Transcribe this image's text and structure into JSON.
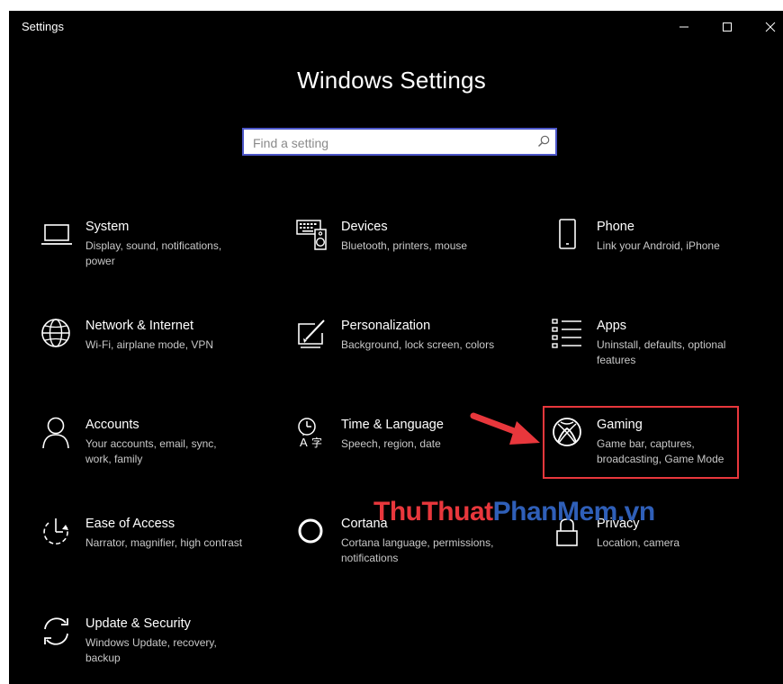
{
  "window": {
    "title": "Settings"
  },
  "header": {
    "title": "Windows Settings"
  },
  "search": {
    "placeholder": "Find a setting",
    "value": ""
  },
  "tiles": [
    {
      "name": "System",
      "description": "Display, sound, notifications, power",
      "icon": "laptop-icon"
    },
    {
      "name": "Devices",
      "description": "Bluetooth, printers, mouse",
      "icon": "keyboard-speaker-icon"
    },
    {
      "name": "Phone",
      "description": "Link your Android, iPhone",
      "icon": "phone-icon"
    },
    {
      "name": "Network & Internet",
      "description": "Wi-Fi, airplane mode, VPN",
      "icon": "globe-icon"
    },
    {
      "name": "Personalization",
      "description": "Background, lock screen, colors",
      "icon": "paintbrush-icon"
    },
    {
      "name": "Apps",
      "description": "Uninstall, defaults, optional features",
      "icon": "apps-list-icon"
    },
    {
      "name": "Accounts",
      "description": "Your accounts, email, sync, work, family",
      "icon": "person-icon"
    },
    {
      "name": "Time & Language",
      "description": "Speech, region, date",
      "icon": "time-language-icon"
    },
    {
      "name": "Gaming",
      "description": "Game bar, captures, broadcasting, Game Mode",
      "icon": "xbox-icon"
    },
    {
      "name": "Ease of Access",
      "description": "Narrator, magnifier, high contrast",
      "icon": "ease-of-access-icon"
    },
    {
      "name": "Cortana",
      "description": "Cortana language, permissions, notifications",
      "icon": "cortana-circle-icon"
    },
    {
      "name": "Privacy",
      "description": "Location, camera",
      "icon": "lock-icon"
    },
    {
      "name": "Update & Security",
      "description": "Windows Update, recovery, backup",
      "icon": "sync-icon"
    }
  ],
  "watermark": {
    "part1": "ThuThuat",
    "part2": "PhanMem",
    "part3": ".vn"
  },
  "colors": {
    "background": "#000000",
    "accent": "#4c56c8",
    "highlight": "#e8373c",
    "description_text": "#c8c8c8"
  }
}
